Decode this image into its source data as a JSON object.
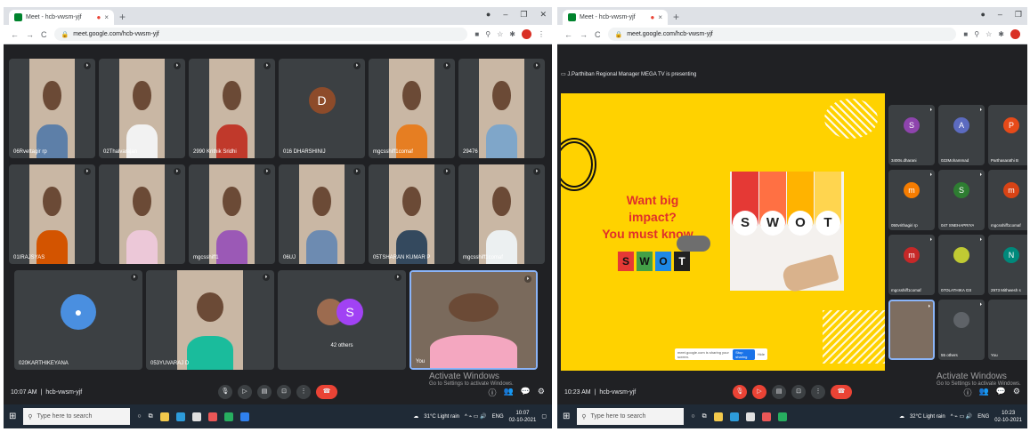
{
  "left": {
    "tab_title": "Meet - hcb-vwsm-yjf",
    "url": "meet.google.com/hcb-vwsm-yjf",
    "tiles": [
      {
        "name": "06Rvettagir rp",
        "type": "photo"
      },
      {
        "name": "02Thalvarajan",
        "type": "photo"
      },
      {
        "name": "2990 Krithik Sridhi",
        "type": "photo"
      },
      {
        "name": "016 DHARSHINIJ",
        "type": "avatar",
        "letter": "D",
        "color": "#8d4b2a"
      },
      {
        "name": "mgcsshiff1comaf",
        "type": "photo"
      },
      {
        "name": "29476",
        "type": "photo"
      },
      {
        "name": "01IRAJSYAS",
        "type": "photo"
      },
      {
        "name": "",
        "type": "photo"
      },
      {
        "name": "mgcsshiff1",
        "type": "photo"
      },
      {
        "name": "06UJ",
        "type": "photo"
      },
      {
        "name": "05TSHARAN KUMAR P",
        "type": "photo"
      },
      {
        "name": "mgcsshiff1comaf",
        "type": "photo"
      },
      {
        "name": "020KARTHIKEYANA",
        "type": "person-icon"
      },
      {
        "name": "053YUVARAJ D",
        "type": "photo"
      },
      {
        "name": "42 others",
        "type": "others",
        "letter": "S"
      },
      {
        "name": "You",
        "type": "self"
      }
    ],
    "time": "10:07 AM",
    "meeting_code": "hcb-vwsm-yjf",
    "activate_title": "Activate Windows",
    "activate_sub": "Go to Settings to activate Windows.",
    "search_placeholder": "Type here to search",
    "weather": "31°C Light rain",
    "lang": "ENG",
    "clock_time": "10:07",
    "clock_date": "02-10-2021"
  },
  "right": {
    "tab_title": "Meet - hcb-vwsm-yjf",
    "url": "meet.google.com/hcb-vwsm-yjf",
    "presenting": "J.Parthiban Regional Manager MEGA TV is presenting",
    "slide": {
      "headline_1": "Want big impact?",
      "headline_2": "You must know...",
      "swot_letters": [
        "S",
        "W",
        "O",
        "T"
      ],
      "swot_colors": [
        "#e53935",
        "#43a047",
        "#1e88e5",
        "#212121"
      ],
      "pic_letters": [
        "S",
        "W",
        "O",
        "T"
      ],
      "notice_text": "meet.google.com is sharing your screen.",
      "stop_label": "Stop sharing",
      "hide_label": "Hide"
    },
    "tiles": [
      {
        "name": "3400s.dharani",
        "letter": "S",
        "color": "#8e44ad"
      },
      {
        "name": "022Mohammad",
        "letter": "A",
        "color": "#5c6bc0"
      },
      {
        "name": "Parthasarathi B",
        "letter": "P",
        "color": "#e64a19"
      },
      {
        "name": "050vrithagiri rp",
        "letter": "m",
        "color": "#f57c00"
      },
      {
        "name": "047 SNEHAPRIYA",
        "letter": "S",
        "color": "#2e7d32"
      },
      {
        "name": "mgcsshiff1comaf",
        "letter": "m",
        "color": "#d84315"
      },
      {
        "name": "mgcsshiff1comaf",
        "letter": "m",
        "color": "#c62828"
      },
      {
        "name": "07OLATHIKA GS",
        "letter": "",
        "color": "#c0ca33"
      },
      {
        "name": "2973 Mithwesh s",
        "letter": "N",
        "color": "#00897b"
      },
      {
        "name": "",
        "letter": "",
        "color": ""
      },
      {
        "name": "55 others",
        "letter": "",
        "color": "#5f6368"
      },
      {
        "name": "You",
        "letter": "",
        "color": ""
      }
    ],
    "time": "10:23 AM",
    "meeting_code": "hcb-vwsm-yjf",
    "activate_title": "Activate Windows",
    "activate_sub": "Go to Settings to activate Windows.",
    "search_placeholder": "Type here to search",
    "weather": "32°C Light rain",
    "lang": "ENG",
    "clock_time": "10:23",
    "clock_date": "02-10-2021"
  }
}
